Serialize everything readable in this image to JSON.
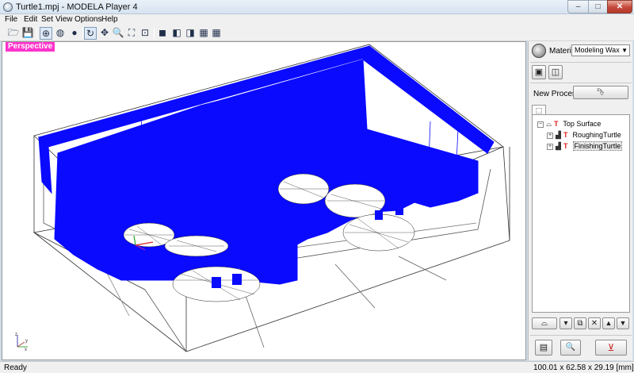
{
  "window": {
    "title": "Turtle1.mpj - MODELA Player 4",
    "min_glyph": "–",
    "max_glyph": "□",
    "close_glyph": "✕"
  },
  "menu": [
    "File",
    "Edit",
    "Set",
    "View",
    "Options",
    "Help"
  ],
  "toolbar": {
    "open": "🗁",
    "save": "💾",
    "view1": "⊕",
    "view2": "◍",
    "view3": "●",
    "rotate": "↻",
    "pan": "✥",
    "zoom": "🔍",
    "fit": "⛶",
    "zoom_window": "⊡",
    "cube1": "◼",
    "cube2": "◧",
    "cube3": "◨",
    "cube4": "▦"
  },
  "viewport": {
    "label": "Perspective",
    "toolpath_color": "#0a0aff",
    "wire_color": "#333333"
  },
  "panel": {
    "material_label": "Material",
    "material_value": "Modeling Wax",
    "material_arrow": "▼",
    "new_process_label": "New Process",
    "new_process_icon": "⮷",
    "btn_a_icon": "▣",
    "btn_b_icon": "◫",
    "tab_icon": "⬚",
    "tree": [
      {
        "label": "Top Surface",
        "selected": false
      },
      {
        "label": "RoughingTurtle",
        "selected": false
      },
      {
        "label": "FinishingTurtle",
        "selected": true
      }
    ],
    "expander_minus": "−",
    "expander_plus": "+",
    "tree_t_glyph": "T",
    "bottom_icons": {
      "surface": "⌓",
      "tool": "▾",
      "copy": "⧉",
      "delete": "✕",
      "up": "▲",
      "down": "▼"
    },
    "action_icons": {
      "list": "▤",
      "preview": "🔍",
      "cut": "⊻"
    }
  },
  "status": {
    "left": "Ready",
    "right": "100.01 x 62.58 x 29.19 [mm]"
  },
  "axis": {
    "x": "x",
    "y": "y",
    "z": "z"
  }
}
